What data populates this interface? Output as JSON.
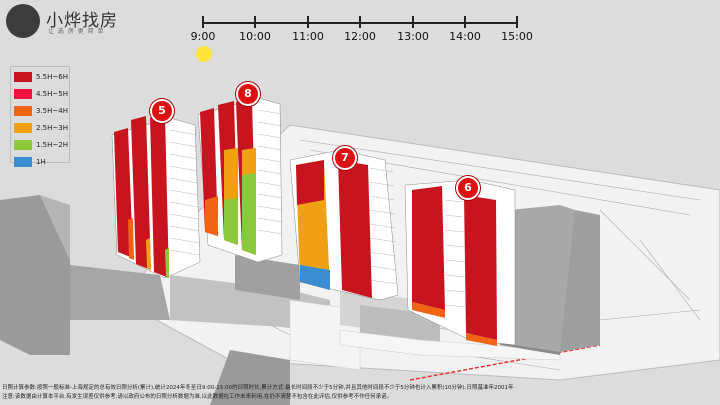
{
  "brand": {
    "name": "小烨找房",
    "tagline": "让 选 房 更 简 单"
  },
  "timeline": {
    "ticks": [
      "9:00",
      "10:00",
      "11:00",
      "12:00",
      "13:00",
      "14:00",
      "15:00"
    ],
    "sun_time": "9:00"
  },
  "legend": {
    "items": [
      {
        "label": "5.5H~6H",
        "color": "#c8141e"
      },
      {
        "label": "4.5H~5H",
        "color": "#f0143c"
      },
      {
        "label": "3.5H~4H",
        "color": "#f06414"
      },
      {
        "label": "2.5H~3H",
        "color": "#f0a014"
      },
      {
        "label": "1.5H~2H",
        "color": "#8cc83c"
      },
      {
        "label": "1H",
        "color": "#3c8cd2"
      }
    ]
  },
  "buildings": [
    {
      "id": "5"
    },
    {
      "id": "8"
    },
    {
      "id": "7"
    },
    {
      "id": "6"
    }
  ],
  "footer": {
    "line1": "日照计算参数:按照一般标准-上海规定的总有效日照分析(累计),统计2024年冬至日9:00-15:00的日照时长,累计方式:最长时间段不少于5分钟,并且其他时间段不少于5分钟也计入累积(10分钟),日照基准年2001年",
    "line2": "注意:该数据由计算本平台,有发生误差仅供参考,请以政府公布的日照分析数据为准,以此数据在工作未来利用,在仍不清楚不包含在此评估,仅供参考不作任何承诺。"
  }
}
